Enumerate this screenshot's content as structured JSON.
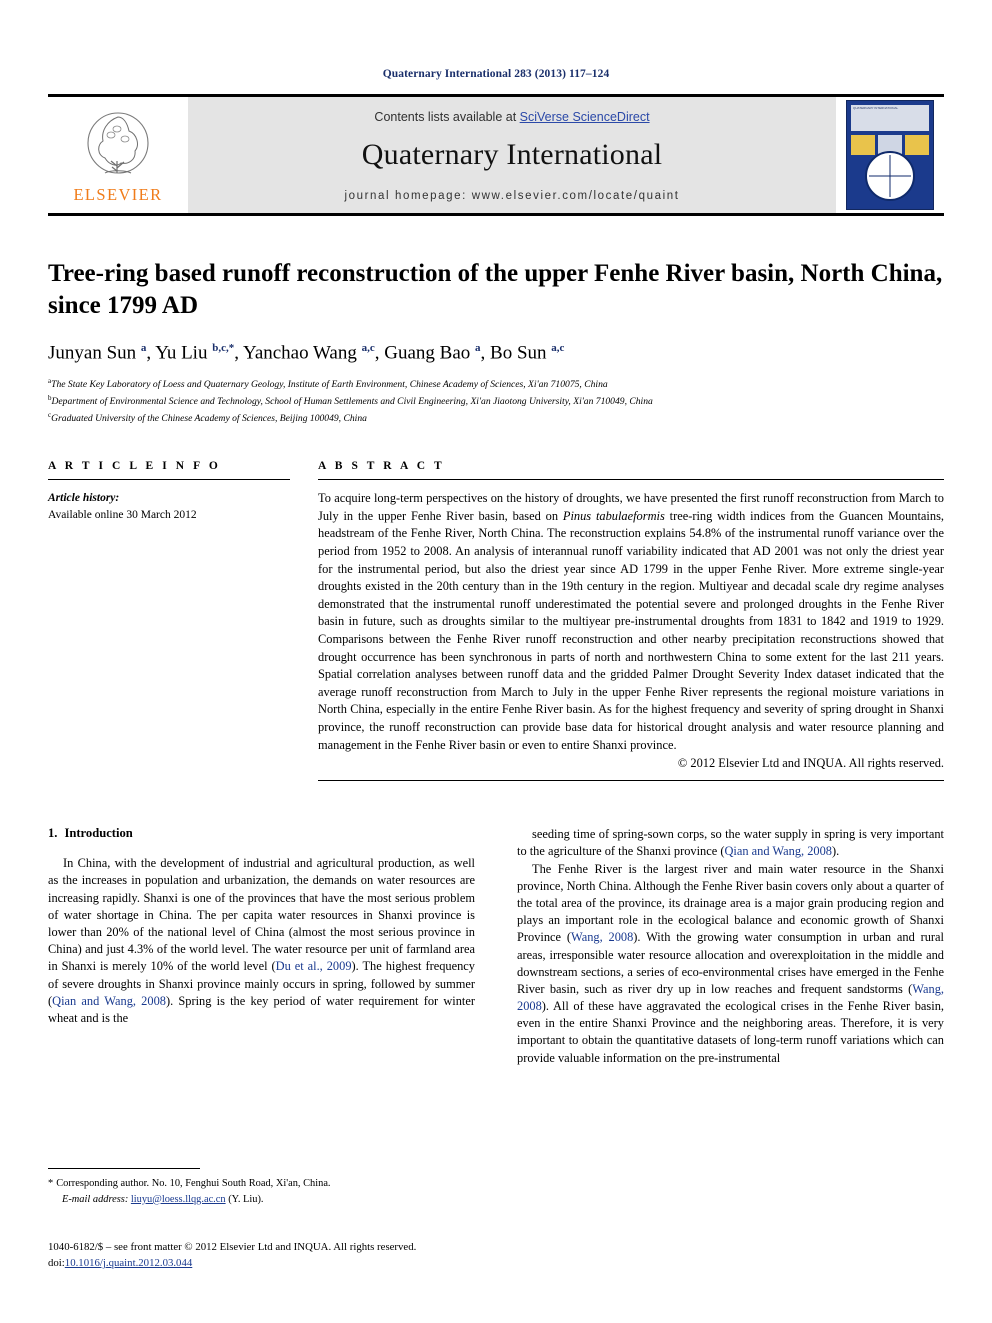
{
  "running_head": "Quaternary International 283 (2013) 117–124",
  "masthead": {
    "contents_prefix": "Contents lists available at ",
    "sciencedirect": "SciVerse ScienceDirect",
    "journal_name": "Quaternary International",
    "homepage": "journal homepage: www.elsevier.com/locate/quaint",
    "publisher": "ELSEVIER",
    "cover_tiny_text": "QUATERNARY INTERNATIONAL"
  },
  "article": {
    "title": "Tree-ring based runoff reconstruction of the upper Fenhe River basin, North China, since 1799 AD",
    "authors_html": "Junyan Sun <sup>a</sup>, Yu Liu <sup>b,c,</sup><sup>*</sup>, Yanchao Wang <sup>a,c</sup>, Guang Bao <sup>a</sup>, Bo Sun <sup>a,c</sup>",
    "affiliations": [
      {
        "marker": "a",
        "text": "The State Key Laboratory of Loess and Quaternary Geology, Institute of Earth Environment, Chinese Academy of Sciences, Xi'an 710075, China"
      },
      {
        "marker": "b",
        "text": "Department of Environmental Science and Technology, School of Human Settlements and Civil Engineering, Xi'an Jiaotong University, Xi'an 710049, China"
      },
      {
        "marker": "c",
        "text": "Graduated University of the Chinese Academy of Sciences, Beijing 100049, China"
      }
    ]
  },
  "article_info": {
    "heading": "A R T I C L E   I N F O",
    "history_label": "Article history:",
    "history_value": "Available online 30 March 2012"
  },
  "abstract": {
    "heading": "A B S T R A C T",
    "text_html": "To acquire long-term perspectives on the history of droughts, we have presented the first runoff reconstruction from March to July in the upper Fenhe River basin, based on <i>Pinus tabulaeformis</i> tree-ring width indices from the Guancen Mountains, headstream of the Fenhe River, North China. The reconstruction explains 54.8% of the instrumental runoff variance over the period from 1952 to 2008. An analysis of interannual runoff variability indicated that AD 2001 was not only the driest year for the instrumental period, but also the driest year since AD 1799 in the upper Fenhe River. More extreme single-year droughts existed in the 20th century than in the 19th century in the region. Multiyear and decadal scale dry regime analyses demonstrated that the instrumental runoff underestimated the potential severe and prolonged droughts in the Fenhe River basin in future, such as droughts similar to the multiyear pre-instrumental droughts from 1831 to 1842 and 1919 to 1929. Comparisons between the Fenhe River runoff reconstruction and other nearby precipitation reconstructions showed that drought occurrence has been synchronous in parts of north and northwestern China to some extent for the last 211 years. Spatial correlation analyses between runoff data and the gridded Palmer Drought Severity Index dataset indicated that the average runoff reconstruction from March to July in the upper Fenhe River represents the regional moisture variations in North China, especially in the entire Fenhe River basin. As for the highest frequency and severity of spring drought in Shanxi province, the runoff reconstruction can provide base data for historical drought analysis and water resource planning and management in the Fenhe River basin or even to entire Shanxi province.",
    "copyright": "© 2012 Elsevier Ltd and INQUA. All rights reserved."
  },
  "introduction": {
    "number": "1.",
    "title": "Introduction",
    "left_paragraphs_html": [
      "In China, with the development of industrial and agricultural production, as well as the increases in population and urbanization, the demands on water resources are increasing rapidly. Shanxi is one of the provinces that have the most serious problem of water shortage in China. The per capita water resources in Shanxi province is lower than 20% of the national level of China (almost the most serious province in China) and just 4.3% of the world level. The water resource per unit of farmland area in Shanxi is merely 10% of the world level (<span class=\"cite\">Du et al., 2009</span>). The highest frequency of severe droughts in Shanxi province mainly occurs in spring, followed by summer (<span class=\"cite\">Qian and Wang, 2008</span>). Spring is the key period of water requirement for winter wheat and is the"
    ],
    "right_paragraphs_html": [
      "seeding time of spring-sown corps, so the water supply in spring is very important to the agriculture of the Shanxi province (<span class=\"cite\">Qian and Wang, 2008</span>).",
      "The Fenhe River is the largest river and main water resource in the Shanxi province, North China. Although the Fenhe River basin covers only about a quarter of the total area of the province, its drainage area is a major grain producing region and plays an important role in the ecological balance and economic growth of Shanxi Province (<span class=\"cite\">Wang, 2008</span>). With the growing water consumption in urban and rural areas, irresponsible water resource allocation and overexploitation in the middle and downstream sections, a series of eco-environmental crises have emerged in the Fenhe River basin, such as river dry up in low reaches and frequent sandstorms (<span class=\"cite\">Wang, 2008</span>). All of these have aggravated the ecological crises in the Fenhe River basin, even in the entire Shanxi Province and the neighboring areas. Therefore, it is very important to obtain the quantitative datasets of long-term runoff variations which can provide valuable information on the pre-instrumental"
    ]
  },
  "footnotes": {
    "corresponding_star": "*",
    "corresponding_text": "Corresponding author. No. 10, Fenghui South Road, Xi'an, China.",
    "email_label": "E-mail address:",
    "email_value": "liuyu@loess.llqg.ac.cn",
    "email_suffix": "(Y. Liu)."
  },
  "footer": {
    "issn_line": "1040-6182/$ – see front matter © 2012 Elsevier Ltd and INQUA. All rights reserved.",
    "doi_label": "doi:",
    "doi_value": "10.1016/j.quaint.2012.03.044"
  },
  "colors": {
    "link_blue": "#2b49a8",
    "cite_blue": "#1a3a8f",
    "running_head_blue": "#1a2f6b",
    "elsevier_orange": "#f07c1a",
    "masthead_grey": "#e4e4e4",
    "cover_navy": "#1b3a8c"
  }
}
